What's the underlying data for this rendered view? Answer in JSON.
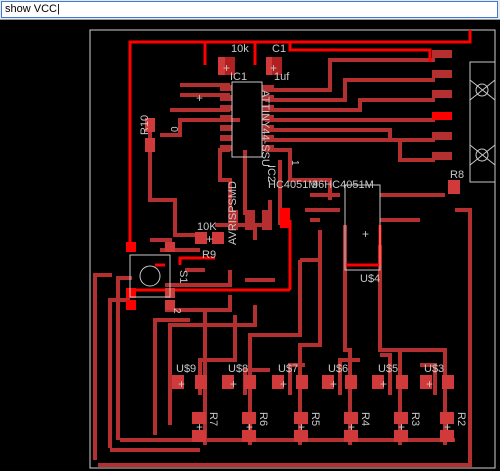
{
  "command_line": {
    "value": "show VCC|"
  },
  "components": {
    "resistor_10k": "10k",
    "cap_c1": "C1",
    "cap_value": "1uf",
    "ic1_name": "IC1",
    "ic1_part": "ATTINY44-SSU",
    "ic1_pin1": "1",
    "ic2_name": "IC2",
    "ic2_part": "HC4051M",
    "u4_part": "96HC4051M",
    "u4_name": "U$4",
    "r10_name": "R10",
    "r10_value": "0",
    "r9_name": "R9",
    "r9_value": "10K",
    "avr_header": "AVRISPSMD",
    "s1_name": "S1",
    "s1_pin2": "2",
    "r8_name": "R8",
    "u9": "U$9",
    "u8": "U$8",
    "u7": "U$7",
    "u6": "U$6",
    "u5": "U$5",
    "u3": "U$3",
    "r7": "R7",
    "r6": "R6",
    "r5": "R5",
    "r4": "R4",
    "r3": "R3",
    "r2": "R2"
  },
  "colors": {
    "trace": "#b43030",
    "highlight": "#ff0000",
    "silk": "#c8c8c8",
    "pad": "#d03a3a"
  }
}
